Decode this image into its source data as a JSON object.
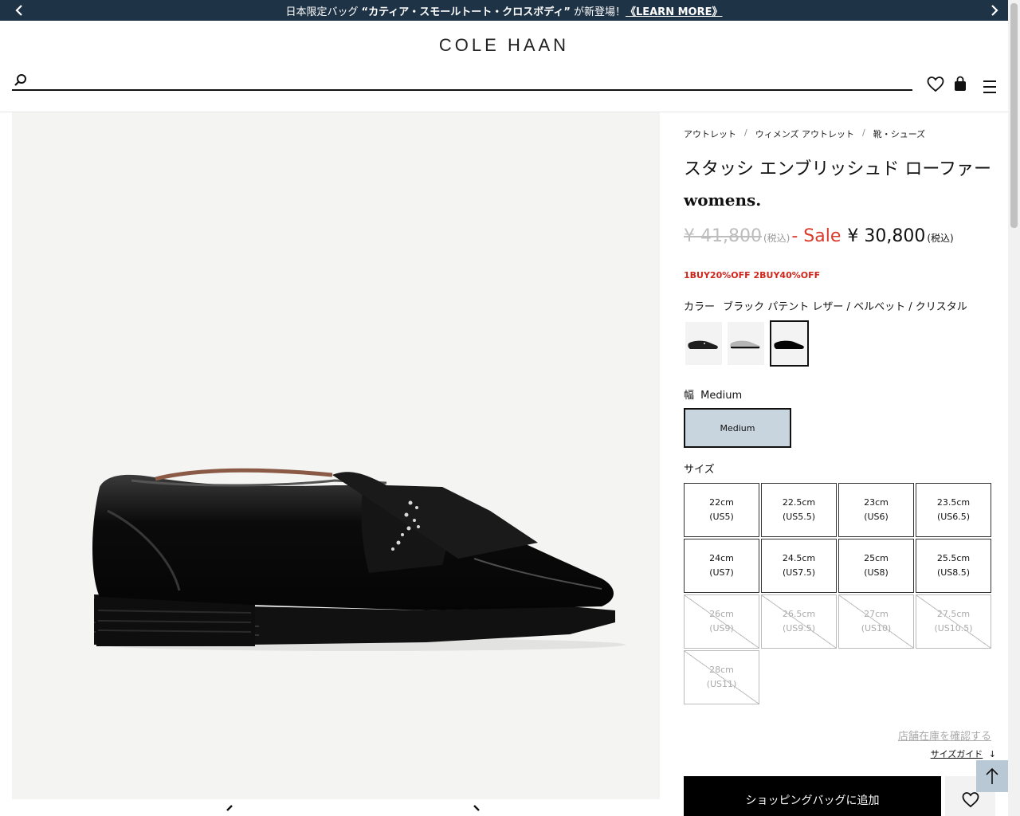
{
  "banner": {
    "prefix": "日本限定バッグ",
    "highlight": "“カティア・スモールトート・クロスボディ”",
    "suffix": "が新登場！",
    "link": "《LEARN MORE》",
    "prev_icon": "chevron-left-icon",
    "next_icon": "chevron-right-icon"
  },
  "header": {
    "logo": "COLE HAAN",
    "search_placeholder": "",
    "icons": [
      "search-icon",
      "heart-icon",
      "bag-icon",
      "menu-icon"
    ]
  },
  "breadcrumb": [
    "アウトレット",
    "ウィメンズ アウトレット",
    "靴・シューズ"
  ],
  "breadcrumb_sep": "/",
  "product": {
    "name": "スタッシ エンブリッシュド ローファー",
    "gender": "womens.",
    "original_price": "¥ 41,800",
    "tax_note": "(税込)",
    "sale_label": "- Sale",
    "sale_price": "¥ 30,800",
    "sale_tax_note": "(税込)",
    "promo": "1BUY20%OFF 2BUY40%OFF",
    "color_label": "カラー",
    "color_value": "ブラック パテント レザー / ベルベット / クリスタル",
    "swatches": [
      {
        "label": "black-silver",
        "color": "#2a2a2a"
      },
      {
        "label": "silver",
        "color": "#bfbfbf"
      },
      {
        "label": "black-patent",
        "color": "#0a0a0a",
        "selected": true
      }
    ],
    "width_label": "幅",
    "width_value": "Medium",
    "width_option": "Medium",
    "size_label": "サイズ",
    "sizes": [
      {
        "cm": "22cm",
        "us": "(US5)",
        "available": true
      },
      {
        "cm": "22.5cm",
        "us": "(US5.5)",
        "available": true
      },
      {
        "cm": "23cm",
        "us": "(US6)",
        "available": true
      },
      {
        "cm": "23.5cm",
        "us": "(US6.5)",
        "available": true
      },
      {
        "cm": "24cm",
        "us": "(US7)",
        "available": true
      },
      {
        "cm": "24.5cm",
        "us": "(US7.5)",
        "available": true
      },
      {
        "cm": "25cm",
        "us": "(US8)",
        "available": true
      },
      {
        "cm": "25.5cm",
        "us": "(US8.5)",
        "available": true
      },
      {
        "cm": "26cm",
        "us": "(US9)",
        "available": false
      },
      {
        "cm": "26.5cm",
        "us": "(US9.5)",
        "available": false
      },
      {
        "cm": "27cm",
        "us": "(US10)",
        "available": false
      },
      {
        "cm": "27.5cm",
        "us": "(US10.5)",
        "available": false
      },
      {
        "cm": "28cm",
        "us": "(US11)",
        "available": false
      }
    ],
    "store_stock_link": "店舗在庫を確認する",
    "size_guide": "サイズガイド",
    "size_guide_arrow": "↓",
    "add_to_bag": "ショッピングバッグに追加"
  },
  "colors": {
    "banner_bg": "#1f3346",
    "sale_red": "#d93a2b",
    "promo_red": "#d0261c",
    "width_selected_bg": "#c9d5de",
    "back_to_top_bg": "#b8c8d4"
  }
}
